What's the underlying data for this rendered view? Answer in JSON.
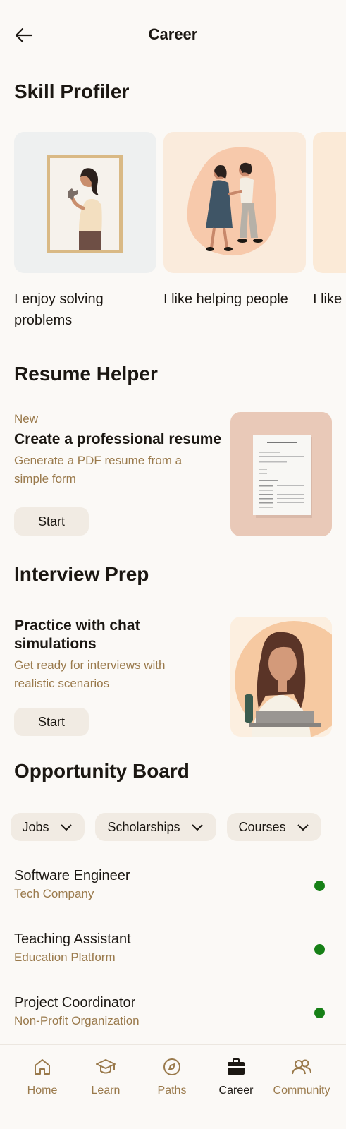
{
  "header": {
    "title": "Career",
    "back_icon": "arrow-left-icon"
  },
  "skill_profiler": {
    "title": "Skill Profiler",
    "cards": [
      {
        "label": "I enjoy solving problems",
        "image": "woman-holding-puzzle-piece-in-frame"
      },
      {
        "label": "I like helping people",
        "image": "two-women-supporting-each-other"
      },
      {
        "label": "I like",
        "image": "partial-card"
      }
    ]
  },
  "resume_helper": {
    "title": "Resume Helper",
    "badge": "New",
    "card_title": "Create a professional resume",
    "card_subtitle": "Generate a PDF resume from a simple form",
    "button": "Start",
    "image": "resume-document-illustration"
  },
  "interview_prep": {
    "title": "Interview Prep",
    "card_title": "Practice with chat simulations",
    "card_subtitle": "Get ready for interviews with realistic scenarios",
    "button": "Start",
    "image": "woman-with-laptop-illustration"
  },
  "opportunity_board": {
    "title": "Opportunity Board",
    "filters": [
      {
        "label": "Jobs",
        "icon": "chevron-down-icon"
      },
      {
        "label": "Scholarships",
        "icon": "chevron-down-icon"
      },
      {
        "label": "Courses",
        "icon": "chevron-down-icon"
      }
    ],
    "items": [
      {
        "title": "Software Engineer",
        "org": "Tech Company",
        "status_color": "#168016"
      },
      {
        "title": "Teaching Assistant",
        "org": "Education Platform",
        "status_color": "#168016"
      },
      {
        "title": "Project Coordinator",
        "org": "Non-Profit Organization",
        "status_color": "#168016"
      }
    ]
  },
  "bottom_nav": {
    "items": [
      {
        "label": "Home",
        "icon": "home-icon"
      },
      {
        "label": "Learn",
        "icon": "graduation-cap-icon"
      },
      {
        "label": "Paths",
        "icon": "compass-icon"
      },
      {
        "label": "Career",
        "icon": "briefcase-icon",
        "active": true
      },
      {
        "label": "Community",
        "icon": "people-icon"
      }
    ]
  },
  "colors": {
    "accent": "#9a7a4c",
    "background": "#fbf9f6",
    "chip": "#f1ebe3",
    "status_green": "#168016"
  }
}
